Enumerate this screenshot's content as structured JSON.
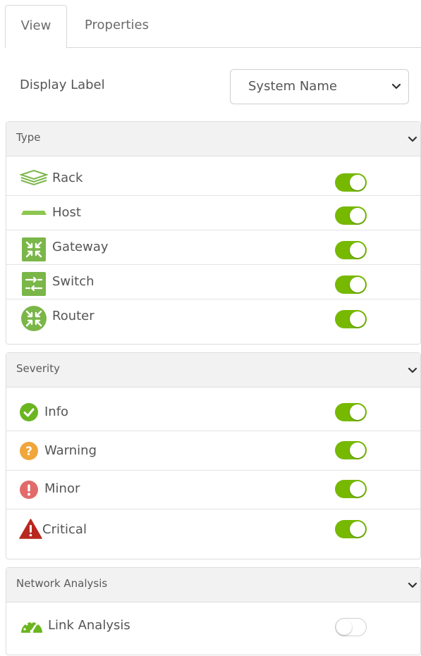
{
  "tabs": [
    {
      "label": "View",
      "active": true
    },
    {
      "label": "Properties",
      "active": false
    }
  ],
  "display_label": {
    "label": "Display Label",
    "selected": "System Name"
  },
  "panels": {
    "type": {
      "title": "Type",
      "items": [
        {
          "label": "Rack",
          "icon": "rack-icon",
          "enabled": true
        },
        {
          "label": "Host",
          "icon": "host-icon",
          "enabled": true
        },
        {
          "label": "Gateway",
          "icon": "gateway-icon",
          "enabled": true
        },
        {
          "label": "Switch",
          "icon": "switch-icon",
          "enabled": true
        },
        {
          "label": "Router",
          "icon": "router-icon",
          "enabled": true
        }
      ]
    },
    "severity": {
      "title": "Severity",
      "items": [
        {
          "label": "Info",
          "icon": "info-check-icon",
          "enabled": true
        },
        {
          "label": "Warning",
          "icon": "warning-question-icon",
          "enabled": true
        },
        {
          "label": "Minor",
          "icon": "minor-exclamation-icon",
          "enabled": true
        },
        {
          "label": "Critical",
          "icon": "critical-triangle-icon",
          "enabled": true
        }
      ]
    },
    "network": {
      "title": "Network Analysis",
      "items": [
        {
          "label": "Link Analysis",
          "icon": "speedometer-icon",
          "enabled": false
        }
      ]
    }
  },
  "colors": {
    "toggle_on": "#76b900",
    "device_green": "#7ab648",
    "info_green": "#6bb51f",
    "warning_orange": "#f0a63b",
    "minor_red": "#e26a6a",
    "critical_red": "#b8281f"
  }
}
